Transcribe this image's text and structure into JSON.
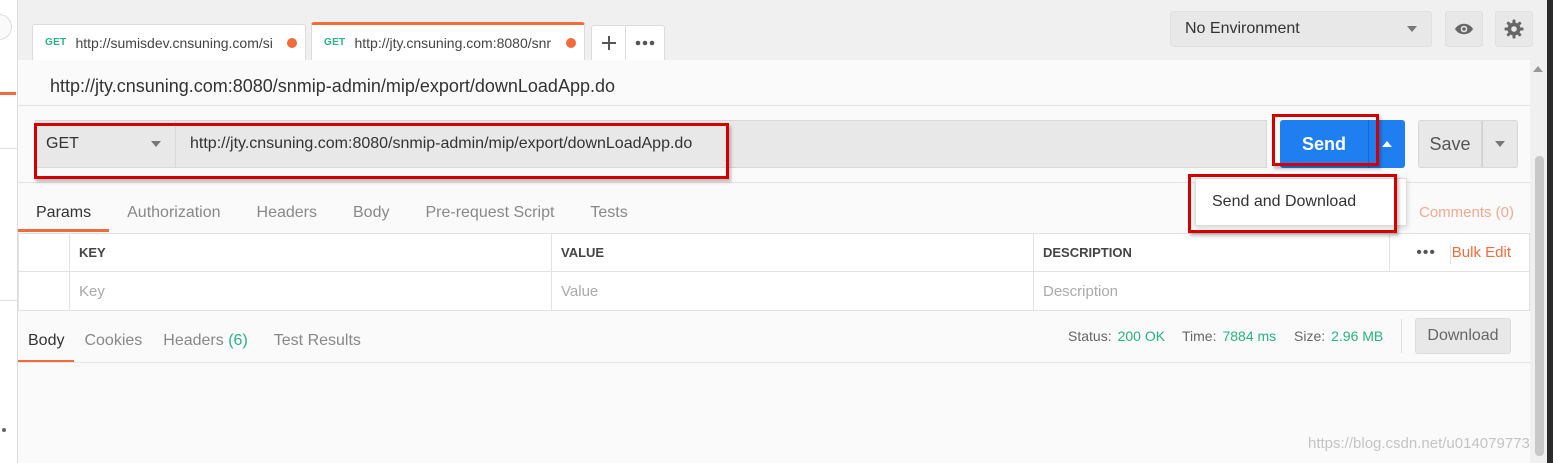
{
  "tabs": [
    {
      "method": "GET",
      "url": "http://sumisdev.cnsuning.com/si",
      "active": false
    },
    {
      "method": "GET",
      "url": "http://jty.cnsuning.com:8080/snr",
      "active": true
    }
  ],
  "tab_actions": {
    "add_icon": "plus-icon",
    "more_icon": "ellipsis-icon"
  },
  "environment": {
    "selected": "No Environment",
    "eye_icon": "eye-icon",
    "settings_icon": "gear-icon"
  },
  "request": {
    "name": "http://jty.cnsuning.com:8080/snmip-admin/mip/export/downLoadApp.do",
    "method": "GET",
    "url": "http://jty.cnsuning.com:8080/snmip-admin/mip/export/downLoadApp.do"
  },
  "actions": {
    "send": "Send",
    "save": "Save",
    "dropdown_item": "Send and Download"
  },
  "request_tabs": [
    "Params",
    "Authorization",
    "Headers",
    "Body",
    "Pre-request Script",
    "Tests"
  ],
  "comments": "Comments (0)",
  "params": {
    "headers": {
      "key": "KEY",
      "value": "VALUE",
      "description": "DESCRIPTION"
    },
    "placeholders": {
      "key": "Key",
      "value": "Value",
      "description": "Description"
    },
    "more": "•••",
    "bulk_edit": "Bulk Edit"
  },
  "response_tabs": {
    "body": "Body",
    "cookies": "Cookies",
    "headers": "Headers",
    "headers_count": "(6)",
    "tests": "Test Results"
  },
  "status": {
    "status_label": "Status:",
    "status_value": "200 OK",
    "time_label": "Time:",
    "time_value": "7884 ms",
    "size_label": "Size:",
    "size_value": "2.96 MB"
  },
  "download": "Download",
  "watermark": "https://blog.csdn.net/u014079773",
  "colors": {
    "accent": "#f26b3a",
    "primary": "#1f7ff0",
    "success": "#26b47f",
    "highlight": "#d40000"
  }
}
